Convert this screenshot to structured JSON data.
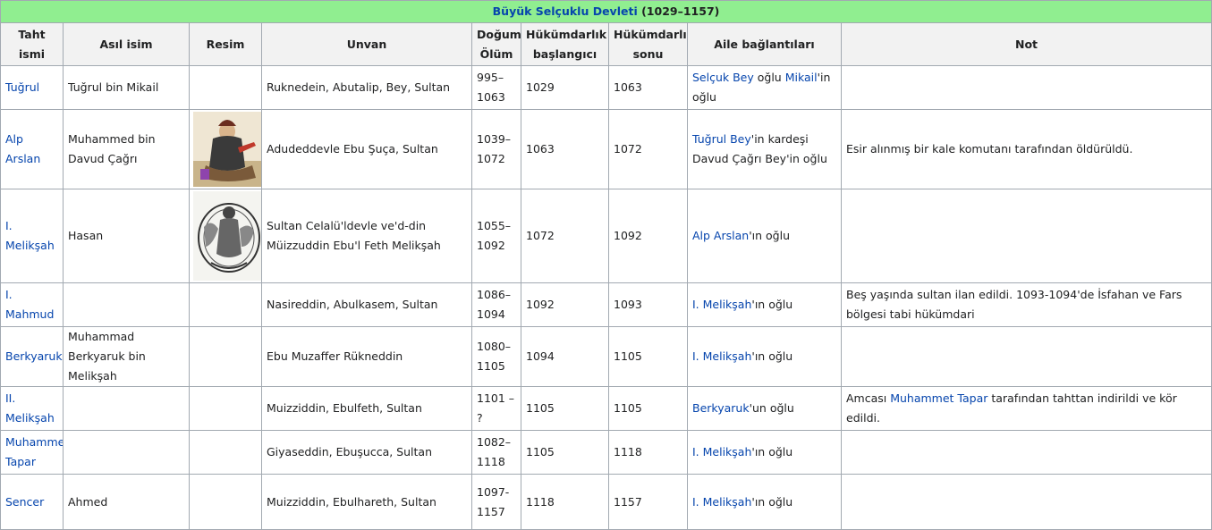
{
  "caption": {
    "title": "Büyük Selçuklu Devleti",
    "years": "(1029–1157)"
  },
  "headers": [
    "Taht ismi",
    "Asıl isim",
    "Resim",
    "Unvan",
    "Doğum-Ölüm",
    "Hükümdarlık başlangıcı",
    "Hükümdarlık sonu",
    "Aile bağlantıları",
    "Not"
  ],
  "rows": [
    {
      "taht": "Tuğrul",
      "asil": "Tuğrul bin Mikail",
      "unvan": "Ruknedein, Abutalip, Bey, Sultan",
      "dogum": "995–1063",
      "bas": "1029",
      "son": "1063",
      "aile": [
        {
          "t": "Selçuk Bey",
          "l": true
        },
        {
          "t": " oğlu ",
          "l": false
        },
        {
          "t": "Mikail",
          "l": true
        },
        {
          "t": "'in oğlu",
          "l": false
        }
      ],
      "not": []
    },
    {
      "taht": "Alp Arslan",
      "asil": "Muhammed bin Davud Çağrı",
      "unvan": "Adudeddevle Ebu Şuça, Sultan",
      "dogum": "1039–1072",
      "bas": "1063",
      "son": "1072",
      "aile": [
        {
          "t": "Tuğrul Bey",
          "l": true
        },
        {
          "t": "'in kardeşi Davud Çağrı Bey'in oğlu",
          "l": false
        }
      ],
      "not": [
        {
          "t": "Esir alınmış bir kale komutanı tarafından öldürüldü.",
          "l": false
        }
      ],
      "img": "portrait-1"
    },
    {
      "taht": "I. Melikşah",
      "asil": "Hasan",
      "unvan": "Sultan Celalü'ldevle ve'd-din Müizzuddin Ebu'l Feth Melikşah",
      "dogum": "1055–1092",
      "bas": "1072",
      "son": "1092",
      "aile": [
        {
          "t": "Alp Arslan",
          "l": true
        },
        {
          "t": "'ın oğlu",
          "l": false
        }
      ],
      "not": [],
      "img": "portrait-2"
    },
    {
      "taht": "I. Mahmud",
      "asil": "",
      "unvan": "Nasireddin, Abulkasem, Sultan",
      "dogum": "1086–1094",
      "bas": "1092",
      "son": "1093",
      "aile": [
        {
          "t": "I. Melikşah",
          "l": true
        },
        {
          "t": "'ın oğlu",
          "l": false
        }
      ],
      "not": [
        {
          "t": "Beş yaşında sultan ilan edildi. 1093-1094'de İsfahan ve Fars bölgesi tabi hükümdari",
          "l": false
        }
      ]
    },
    {
      "taht": "Berkyaruk",
      "asil": "Muhammad Berkyaruk bin Melikşah",
      "unvan": "Ebu Muzaffer Rükneddin",
      "dogum": "1080–1105",
      "bas": "1094",
      "son": "1105",
      "aile": [
        {
          "t": "I. Melikşah",
          "l": true
        },
        {
          "t": "'ın oğlu",
          "l": false
        }
      ],
      "not": []
    },
    {
      "taht": "II. Melikşah",
      "asil": "",
      "unvan": "Muizziddin, Ebulfeth, Sultan",
      "dogum": "1101 – ?",
      "bas": "1105",
      "son": "1105",
      "aile": [
        {
          "t": "Berkyaruk",
          "l": true
        },
        {
          "t": "'un oğlu",
          "l": false
        }
      ],
      "not": [
        {
          "t": "Amcası ",
          "l": false
        },
        {
          "t": "Muhammet Tapar",
          "l": true
        },
        {
          "t": " tarafından tahttan indirildi ve kör edildi.",
          "l": false
        }
      ]
    },
    {
      "taht": "Muhammet Tapar",
      "asil": "",
      "unvan": "Giyaseddin, Ebuşucca, Sultan",
      "dogum": "1082–1118",
      "bas": "1105",
      "son": "1118",
      "aile": [
        {
          "t": "I. Melikşah",
          "l": true
        },
        {
          "t": "'ın oğlu",
          "l": false
        }
      ],
      "not": []
    },
    {
      "taht": "Sencer",
      "asil": "Ahmed",
      "unvan": "Muizziddin, Ebulhareth, Sultan",
      "dogum": "1097-1157",
      "bas": "1118",
      "son": "1157",
      "aile": [
        {
          "t": "I. Melikşah",
          "l": true
        },
        {
          "t": "'ın oğlu",
          "l": false
        }
      ],
      "not": []
    }
  ]
}
